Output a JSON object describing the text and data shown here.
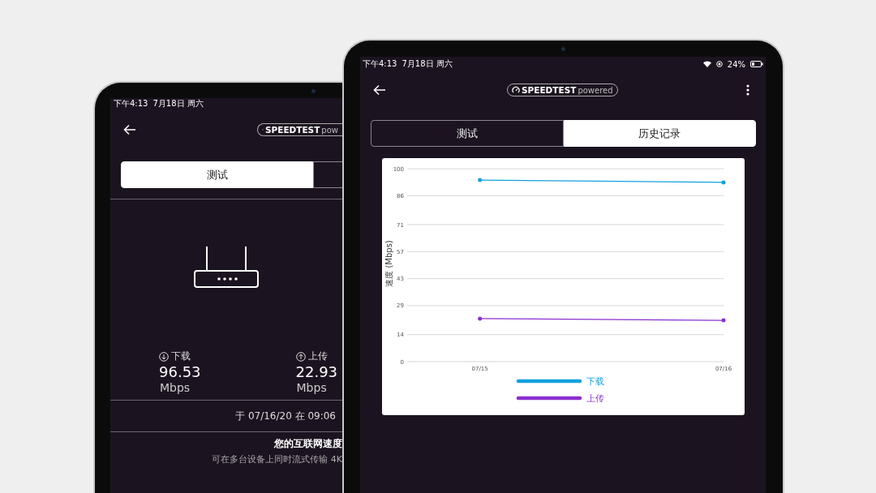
{
  "left_tablet": {
    "status_bar": {
      "time": "下午4:13",
      "date": "7月18日 周六"
    },
    "logo": {
      "brand": "SPEEDTEST",
      "suffix": "pow"
    },
    "tabs": [
      {
        "label": "测试",
        "selected": true
      },
      {
        "selected": false
      }
    ],
    "results": [
      {
        "kind": "download",
        "label": "下载",
        "value": "96.53",
        "unit": "Mbps"
      },
      {
        "kind": "upload",
        "label": "上传",
        "value": "22.93",
        "unit": "Mbps"
      }
    ],
    "timestamp": "于 07/16/20 在 09:06",
    "headline": "您的互联网速度",
    "detail": "可在多台设备上同时流式传输 4K"
  },
  "right_tablet": {
    "status_bar": {
      "time": "下午4:13",
      "date": "7月18日 周六",
      "battery": "24%"
    },
    "logo": {
      "brand": "SPEEDTEST",
      "suffix": "powered"
    },
    "tabs": [
      {
        "label": "测试",
        "selected": false
      },
      {
        "label": "历史记录",
        "selected": true
      }
    ],
    "chart_data": {
      "type": "line",
      "grid": true,
      "ylabel": "速度 (Mbps)",
      "categories": [
        "07/15",
        "07/16"
      ],
      "ylim": [
        0,
        100
      ],
      "yticks": [
        0,
        14,
        29,
        43,
        57,
        71,
        86,
        100
      ],
      "series": [
        {
          "name": "下载",
          "color": "#12a0de",
          "values": [
            94.1,
            92.9
          ]
        },
        {
          "name": "上传",
          "color": "#8b2fd0",
          "values": [
            22.3,
            21.4
          ]
        }
      ]
    }
  }
}
